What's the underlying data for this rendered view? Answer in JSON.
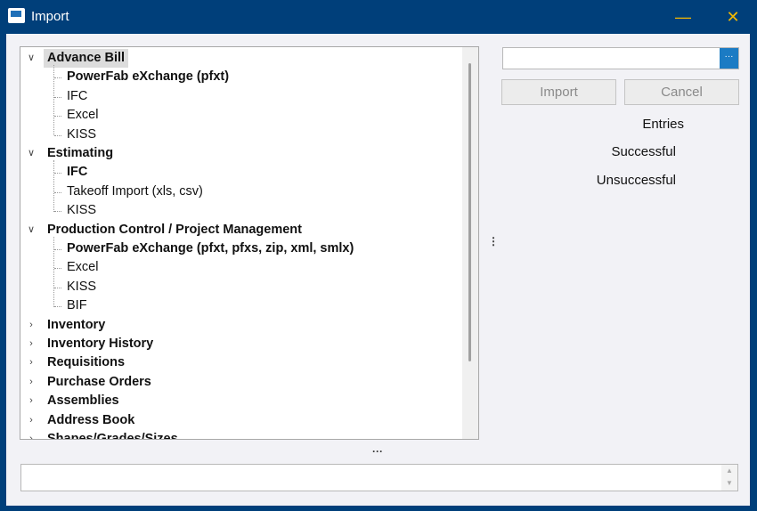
{
  "window": {
    "title": "Import",
    "minimize_icon": "minimize-icon",
    "close_icon": "close-icon"
  },
  "tree": {
    "groups": [
      {
        "label": "Advance Bill",
        "expanded": true,
        "selected": true,
        "children": [
          {
            "label": "PowerFab eXchange (pfxt)",
            "bold": true
          },
          {
            "label": "IFC",
            "bold": false
          },
          {
            "label": "Excel",
            "bold": false
          },
          {
            "label": "KISS",
            "bold": false
          }
        ]
      },
      {
        "label": "Estimating",
        "expanded": true,
        "children": [
          {
            "label": "IFC",
            "bold": true
          },
          {
            "label": "Takeoff Import (xls, csv)",
            "bold": false
          },
          {
            "label": "KISS",
            "bold": false
          }
        ]
      },
      {
        "label": "Production Control / Project Management",
        "expanded": true,
        "children": [
          {
            "label": "PowerFab eXchange (pfxt, pfxs, zip, xml, smlx)",
            "bold": true
          },
          {
            "label": "Excel",
            "bold": false
          },
          {
            "label": "KISS",
            "bold": false
          },
          {
            "label": "BIF",
            "bold": false
          }
        ]
      },
      {
        "label": "Inventory",
        "expanded": false,
        "children": []
      },
      {
        "label": "Inventory History",
        "expanded": false,
        "children": []
      },
      {
        "label": "Requisitions",
        "expanded": false,
        "children": []
      },
      {
        "label": "Purchase Orders",
        "expanded": false,
        "children": []
      },
      {
        "label": "Assemblies",
        "expanded": false,
        "children": []
      },
      {
        "label": "Address Book",
        "expanded": false,
        "children": []
      },
      {
        "label": "Shapes/Grades/Sizes",
        "expanded": false,
        "children": []
      }
    ]
  },
  "file": {
    "value": "",
    "browse_label": "···"
  },
  "buttons": {
    "import": "Import",
    "cancel": "Cancel"
  },
  "stats": {
    "entries": "Entries",
    "successful": "Successful",
    "unsuccessful": "Unsuccessful"
  },
  "log": {
    "value": "",
    "up": "▲",
    "down": "▼"
  },
  "splitter": {
    "v": "⋮",
    "h": "···"
  },
  "colors": {
    "frame": "#003f7a",
    "accent": "#1b7bc4",
    "window_buttons": "#f2b800"
  }
}
